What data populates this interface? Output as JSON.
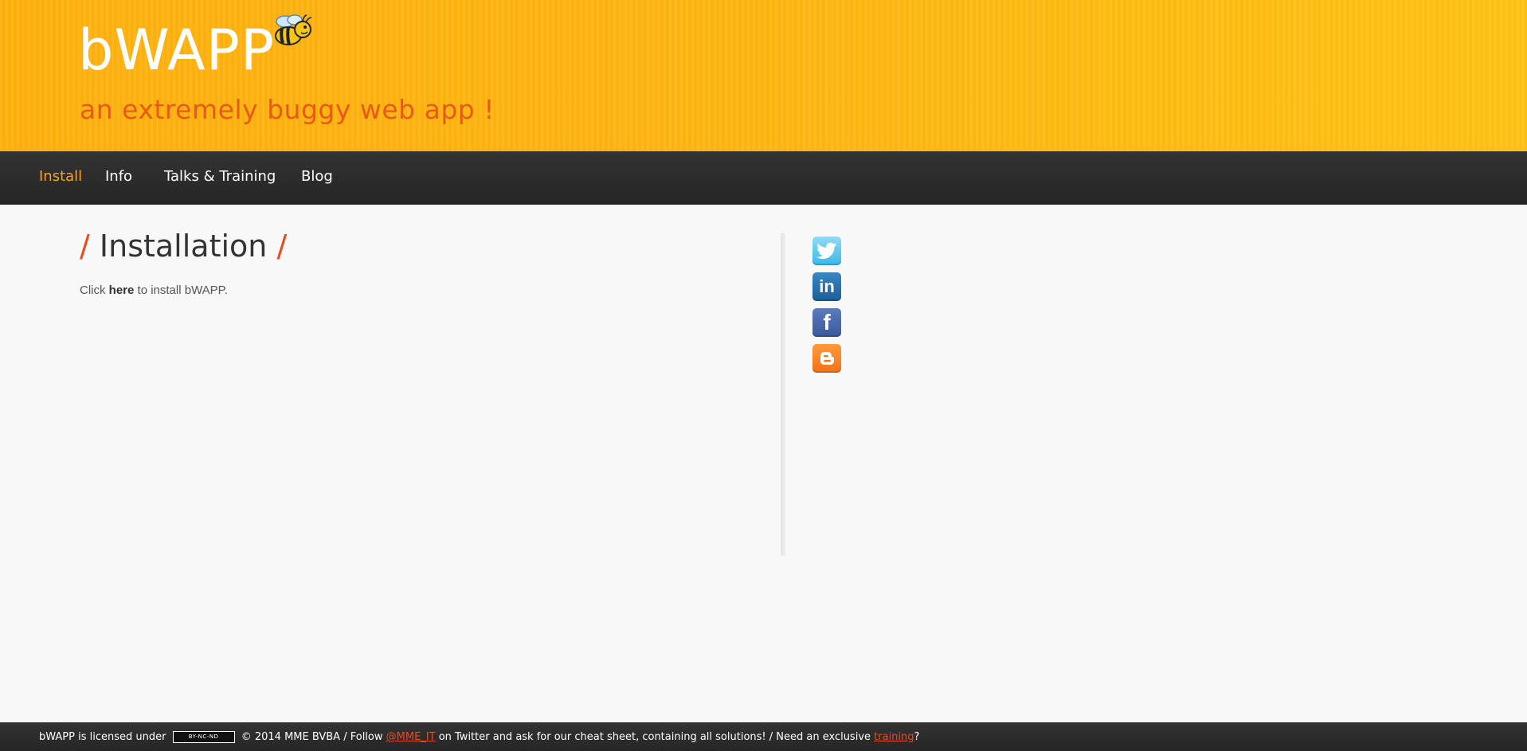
{
  "header": {
    "logo_text": "bWAPP",
    "tagline": "an extremely buggy web app !",
    "mascot_icon": "bee-icon"
  },
  "nav": {
    "items": [
      {
        "label": "Install",
        "active": true
      },
      {
        "label": "Info",
        "active": false
      },
      {
        "label": "Talks & Training",
        "active": false
      },
      {
        "label": "Blog",
        "active": false
      }
    ]
  },
  "main": {
    "title_slash_left": "/",
    "title": "Installation",
    "title_slash_right": "/",
    "install_prefix": "Click ",
    "install_link": "here",
    "install_suffix": " to install bWAPP."
  },
  "social": [
    {
      "name": "twitter-icon",
      "glyph": "t"
    },
    {
      "name": "linkedin-icon",
      "glyph": "in"
    },
    {
      "name": "facebook-icon",
      "glyph": "f"
    },
    {
      "name": "blogger-icon",
      "glyph": "B"
    }
  ],
  "footer": {
    "part1": "bWAPP is licensed under ",
    "cc_badge": "BY-NC-ND",
    "part2": " © 2014 MME BVBA / Follow ",
    "twitter_link": "@MME_IT",
    "part3": " on Twitter and ask for our cheat sheet, containing all solutions! / Need an exclusive ",
    "training_link": "training",
    "part4": "?"
  },
  "colors": {
    "header_bg": "#ffb612",
    "accent_orange": "#ffa31a",
    "accent_red": "#e84b1e",
    "nav_bg": "#2c2c2c"
  }
}
